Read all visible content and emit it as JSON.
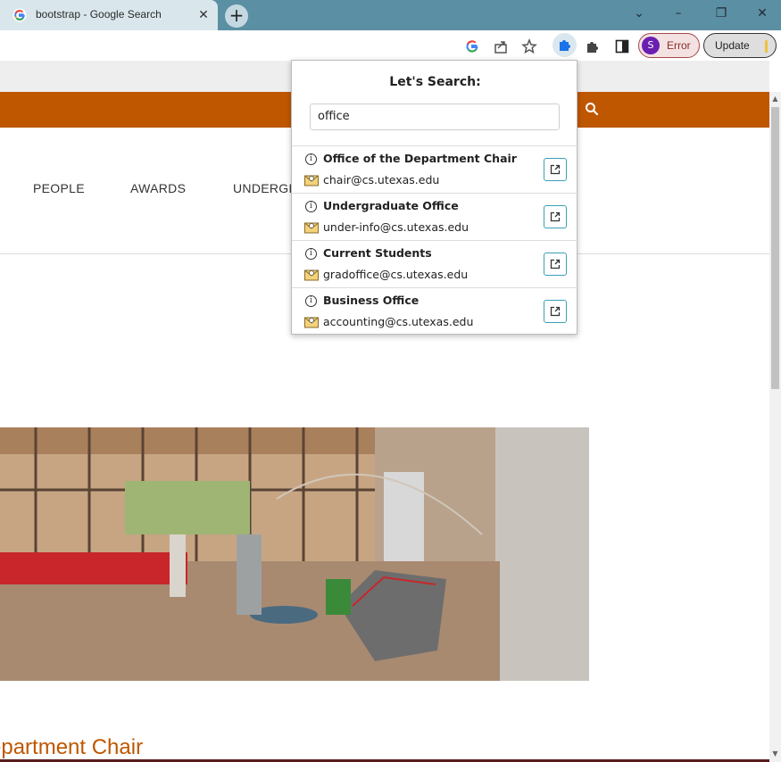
{
  "browser": {
    "tab": {
      "title": "bootstrap - Google Search",
      "close_glyph": "✕",
      "favicon": "google-g-icon"
    },
    "newtab_glyph": "+",
    "window_controls": {
      "minimize": "–",
      "maximize": "❐",
      "close": "✕",
      "tab_search": "⌄"
    },
    "toolbar": {
      "profile": {
        "initial": "S",
        "status": "Error"
      },
      "update_label": "Update"
    },
    "colors": {
      "tabstrip": "#5b8fa3",
      "profile_error": "#a54848",
      "avatar": "#6a1fb0"
    }
  },
  "page": {
    "nav": {
      "items": [
        "PEOPLE",
        "AWARDS",
        "UNDERGR"
      ]
    },
    "section_heading": "epartment Chair",
    "colors": {
      "accent": "#bf5700"
    }
  },
  "popup": {
    "title": "Let's Search:",
    "query": "office",
    "results": [
      {
        "name": "Office of the Department Chair",
        "email": "chair@cs.utexas.edu"
      },
      {
        "name": "Undergraduate Office",
        "email": "under-info@cs.utexas.edu"
      },
      {
        "name": "Current Students",
        "email": "gradoffice@cs.utexas.edu"
      },
      {
        "name": "Business Office",
        "email": "accounting@cs.utexas.edu"
      }
    ],
    "colors": {
      "open_button_border": "#3aa0b5"
    }
  }
}
